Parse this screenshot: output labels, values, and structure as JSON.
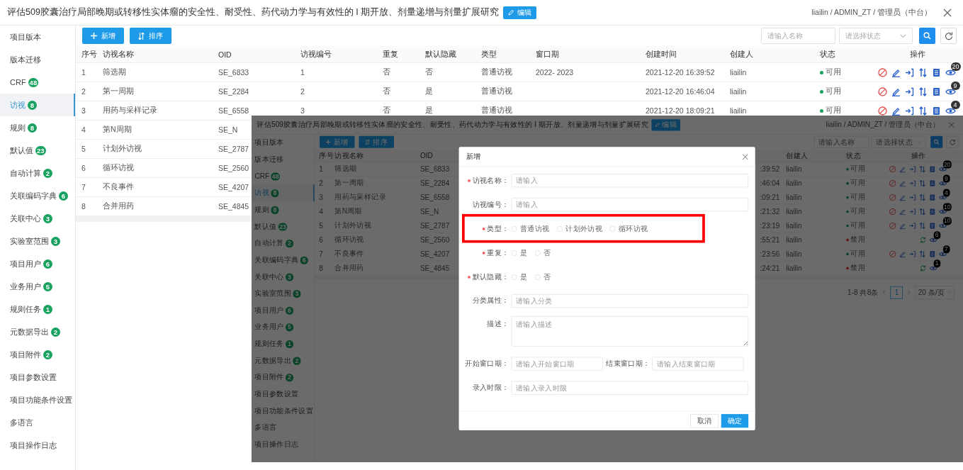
{
  "main": {
    "header": {
      "title": "评估509胶囊治疗局部晚期或转移性实体瘤的安全性、耐受性、药代动力学与有效性的 I 期开放、剂量递增与剂量扩展研究",
      "edit_button": "编辑",
      "user": "liailin / ADMIN_ZT / 管理员（中台）"
    },
    "sidebar": [
      {
        "label": "项目版本",
        "selected": false
      },
      {
        "label": "版本迁移",
        "selected": false
      },
      {
        "label": "CRF",
        "badge": "48",
        "selected": false
      },
      {
        "label": "访视",
        "badge": "8",
        "selected": true
      },
      {
        "label": "规则",
        "badge": "8",
        "selected": false
      },
      {
        "label": "默认值",
        "badge": "23",
        "selected": false
      },
      {
        "label": "自动计算",
        "badge": "2",
        "selected": false
      },
      {
        "label": "关联编码字典",
        "badge": "6",
        "selected": false
      },
      {
        "label": "关联中心",
        "badge": "3",
        "selected": false
      },
      {
        "label": "实验室范围",
        "badge": "3",
        "selected": false
      },
      {
        "label": "项目用户",
        "badge": "6",
        "selected": false
      },
      {
        "label": "业务用户",
        "badge": "5",
        "selected": false
      },
      {
        "label": "规则任务",
        "badge": "1",
        "selected": false
      },
      {
        "label": "元数据导出",
        "badge": "2",
        "selected": false
      },
      {
        "label": "项目附件",
        "badge": "2",
        "selected": false
      },
      {
        "label": "项目参数设置",
        "selected": false
      },
      {
        "label": "项目功能条件设置",
        "selected": false
      },
      {
        "label": "多语言",
        "selected": false
      },
      {
        "label": "项目操作日志",
        "selected": false
      }
    ],
    "toolbar": {
      "add_button": "新增",
      "sort_button": "排序",
      "search_placeholder": "请输入名称",
      "status_placeholder": "请选择状态"
    },
    "table": {
      "columns": {
        "no": "序号",
        "name": "访视名称",
        "oid": "OID",
        "code": "访视编号",
        "repeat": "重复",
        "hidden": "默认隐藏",
        "type": "类型",
        "window": "窗口期",
        "created": "创建时间",
        "creator": "创建人",
        "status": "状态",
        "actions": "操作"
      },
      "rows": [
        {
          "no": "1",
          "name": "筛选期",
          "oid": "SE_6833",
          "code": "1",
          "repeat": "否",
          "hidden": "否",
          "type": "普通访视",
          "window": "2022- 2023",
          "created": "2021-12-20 16:39:52",
          "creator": "liailin",
          "status": "可用",
          "enabled": true,
          "views": "20"
        },
        {
          "no": "2",
          "name": "第一周期",
          "oid": "SE_2284",
          "code": "2",
          "repeat": "否",
          "hidden": "是",
          "type": "普通访视",
          "created": "2021-12-20 16:46:04",
          "creator": "liailin",
          "status": "可用",
          "enabled": true,
          "views": "9"
        },
        {
          "no": "3",
          "name": "用药与采样记录",
          "oid": "SE_6558",
          "code": "3",
          "repeat": "否",
          "hidden": "是",
          "type": "普通访视",
          "created": "2021-12-20 18:09:21",
          "creator": "liailin",
          "status": "可用",
          "enabled": true,
          "views": "4"
        },
        {
          "no": "4",
          "name": "第N周期",
          "oid": "SE_N"
        },
        {
          "no": "5",
          "name": "计划外访视",
          "oid": "SE_2787"
        },
        {
          "no": "6",
          "name": "循环访视",
          "oid": "SE_2560"
        },
        {
          "no": "7",
          "name": "不良事件",
          "oid": "SE_4207"
        },
        {
          "no": "8",
          "name": "合并用药",
          "oid": "SE_4845"
        }
      ]
    }
  },
  "inset": {
    "header": {
      "title": "评估509胶囊治疗局部晚期或转移性实体瘤的安全性、耐受性、药代动力学与有效性的 I 期开放、剂量递增与剂量扩展研究",
      "edit_button": "编辑",
      "user": "liailin / ADMIN_ZT / 管理员（中台）"
    },
    "sidebar": [
      {
        "label": "项目版本",
        "selected": false
      },
      {
        "label": "版本迁移",
        "selected": false
      },
      {
        "label": "CRF",
        "badge": "48",
        "selected": false
      },
      {
        "label": "访视",
        "badge": "8",
        "selected": true
      },
      {
        "label": "规则",
        "badge": "8",
        "selected": false
      },
      {
        "label": "默认值",
        "badge": "23",
        "selected": false
      },
      {
        "label": "自动计算",
        "badge": "2",
        "selected": false
      },
      {
        "label": "关联编码字典",
        "badge": "6",
        "selected": false
      },
      {
        "label": "关联中心",
        "badge": "3",
        "selected": false
      },
      {
        "label": "实验室范围",
        "badge": "3",
        "selected": false
      },
      {
        "label": "项目用户",
        "badge": "6",
        "selected": false
      },
      {
        "label": "业务用户",
        "badge": "5",
        "selected": false
      },
      {
        "label": "规则任务",
        "badge": "1",
        "selected": false
      },
      {
        "label": "元数据导出",
        "badge": "2",
        "selected": false
      },
      {
        "label": "项目附件",
        "badge": "2",
        "selected": false
      },
      {
        "label": "项目参数设置",
        "selected": false
      },
      {
        "label": "项目功能条件设置",
        "selected": false
      },
      {
        "label": "多语言",
        "selected": false
      },
      {
        "label": "项目操作日志",
        "selected": false
      }
    ],
    "toolbar": {
      "add_button": "新增",
      "sort_button": "排序",
      "search_placeholder": "请输入名称",
      "status_placeholder": "请选择状态"
    },
    "table": {
      "columns": {
        "no": "序号",
        "name": "访视名称",
        "oid": "OID",
        "creator": "创建人",
        "status": "状态",
        "actions": "操作"
      },
      "rows": [
        {
          "no": "1",
          "name": "筛选期",
          "oid": "SE_6833",
          "created_tail": ":39:52",
          "creator": "liailin",
          "status": "可用",
          "enabled": true,
          "views": "20"
        },
        {
          "no": "2",
          "name": "第一周期",
          "oid": "SE_2284",
          "created_tail": ":46:04",
          "creator": "liailin",
          "status": "可用",
          "enabled": true,
          "views": "9"
        },
        {
          "no": "3",
          "name": "用药与采样记录",
          "oid": "SE_6558",
          "created_tail": ":09:21",
          "creator": "liailin",
          "status": "可用",
          "enabled": true,
          "views": "4"
        },
        {
          "no": "4",
          "name": "第N周期",
          "oid": "SE_N",
          "created_tail": ":21:32",
          "creator": "liailin",
          "status": "可用",
          "enabled": true,
          "views": "10"
        },
        {
          "no": "5",
          "name": "计划外访视",
          "oid": "SE_2787",
          "created_tail": ":23:19",
          "creator": "liailin",
          "status": "可用",
          "enabled": true,
          "views": "10"
        },
        {
          "no": "6",
          "name": "循环访视",
          "oid": "SE_2560",
          "created_tail": ":55:21",
          "creator": "liailin",
          "status": "禁用",
          "enabled": false,
          "views": "6"
        },
        {
          "no": "7",
          "name": "不良事件",
          "oid": "SE_4207",
          "created_tail": ":23:56",
          "creator": "liailin",
          "status": "可用",
          "enabled": true,
          "views": "7"
        },
        {
          "no": "8",
          "name": "合并用药",
          "oid": "SE_4845",
          "created_tail": ":24:21",
          "creator": "liailin",
          "status": "禁用",
          "enabled": false,
          "views": "1"
        }
      ]
    },
    "pagination": {
      "summary": "1-8 共8条",
      "pages": [
        {
          "label": "1",
          "selected": true
        }
      ],
      "page_size": "20 条/页"
    },
    "modal": {
      "title": "新增",
      "fields": [
        {
          "kind": "text",
          "label": "访视名称：",
          "required": true,
          "highlighted": false,
          "placeholder": "请输入"
        },
        {
          "kind": "text",
          "label": "访视编号：",
          "required": false,
          "highlighted": false,
          "placeholder": "请输入"
        },
        {
          "kind": "radio",
          "label": "类型：",
          "required": true,
          "highlighted": true,
          "options": [
            {
              "label": "普通访视",
              "selected": false
            },
            {
              "label": "计划外访视",
              "selected": false
            },
            {
              "label": "循环访视",
              "selected": false
            }
          ]
        },
        {
          "kind": "radio",
          "label": "重复：",
          "required": true,
          "highlighted": false,
          "options": [
            {
              "label": "是",
              "selected": false
            },
            {
              "label": "否",
              "selected": false
            }
          ]
        },
        {
          "kind": "radio",
          "label": "默认隐藏：",
          "required": true,
          "highlighted": false,
          "options": [
            {
              "label": "是",
              "selected": false
            },
            {
              "label": "否",
              "selected": false
            }
          ]
        },
        {
          "kind": "text",
          "label": "分类属性：",
          "required": false,
          "highlighted": false,
          "placeholder": "请输入分类"
        },
        {
          "kind": "textarea",
          "label": "描述：",
          "required": false,
          "highlighted": false,
          "placeholder": "请输入描述"
        },
        {
          "kind": "pair",
          "required": false,
          "highlighted": false,
          "fields": [
            {
              "label": "开始窗口期：",
              "placeholder": "请输入开始窗口期"
            },
            {
              "label": "结束窗口期：",
              "placeholder": "请输入结束窗口期"
            }
          ]
        },
        {
          "kind": "text",
          "label": "录入时限：",
          "required": false,
          "highlighted": false,
          "placeholder": "请输入录入时限"
        }
      ],
      "cancel_button": "取消",
      "confirm_button": "确定"
    }
  }
}
